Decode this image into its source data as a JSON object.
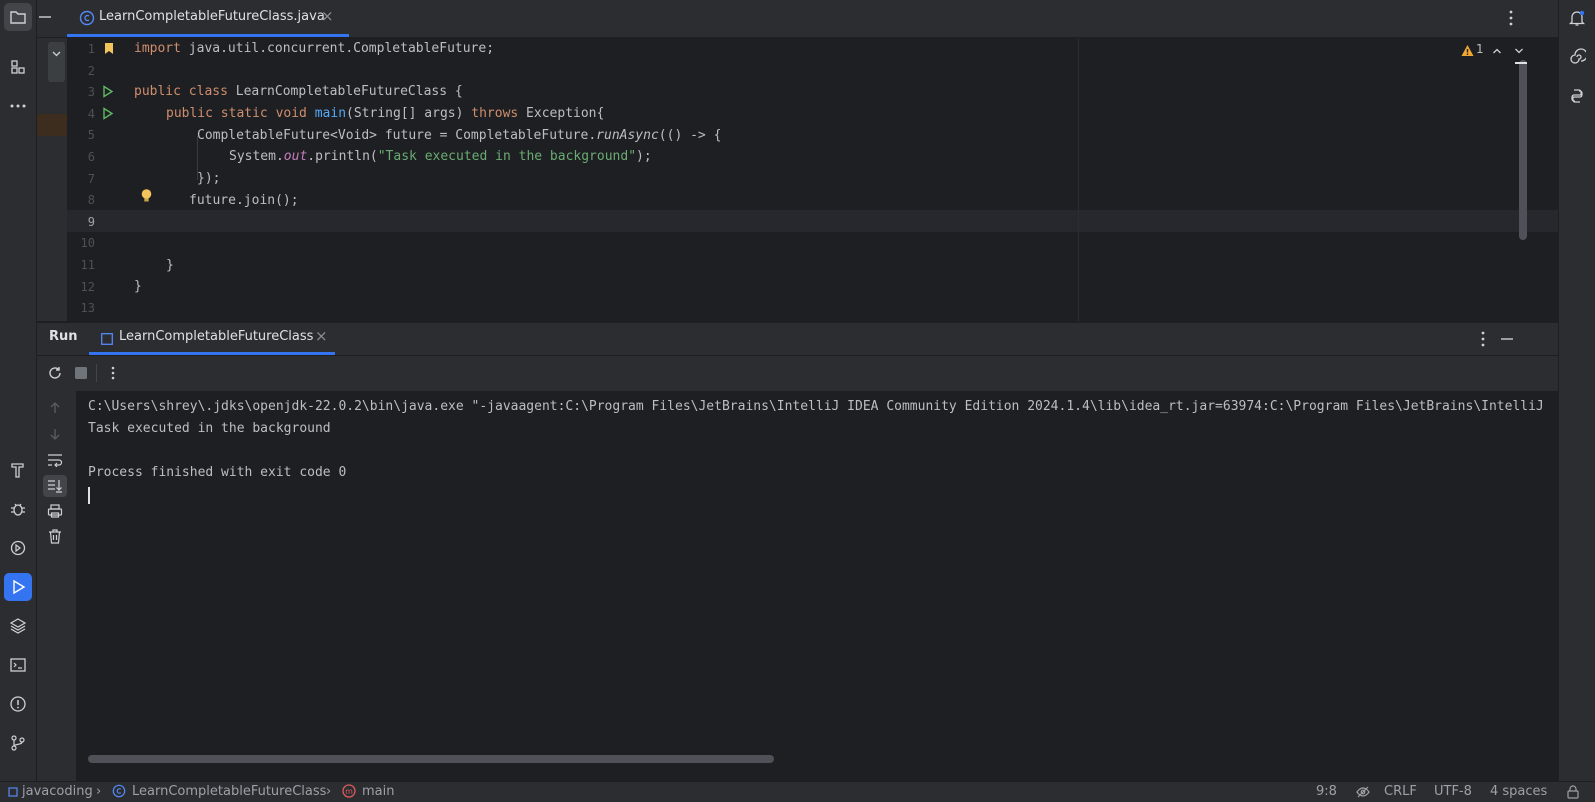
{
  "editor": {
    "tab": {
      "file_name": "LearnCompletableFutureClass.java"
    },
    "inspection": {
      "warning_count": "1"
    },
    "lines": [
      {
        "n": "1"
      },
      {
        "n": "2"
      },
      {
        "n": "3"
      },
      {
        "n": "4"
      },
      {
        "n": "5"
      },
      {
        "n": "6"
      },
      {
        "n": "7"
      },
      {
        "n": "8"
      },
      {
        "n": "9"
      },
      {
        "n": "10"
      },
      {
        "n": "11"
      },
      {
        "n": "12"
      },
      {
        "n": "13"
      }
    ],
    "code": {
      "l1_kw": "import",
      "l1_rest": " java.util.concurrent.CompletableFuture;",
      "l3_kw": "public class",
      "l3_rest": " LearnCompletableFutureClass {",
      "l4_kw1": "public static void",
      "l4_fn": "main",
      "l4_mid": "(String[] args) ",
      "l4_kw2": "throws",
      "l4_rest": " Exception{",
      "l5_a": "CompletableFuture<Void> future = CompletableFuture.",
      "l5_it": "runAsync",
      "l5_b": "(() -> {",
      "l6_a": "System.",
      "l6_it": "out",
      "l6_b": ".println(",
      "l6_str": "\"Task executed in the background\"",
      "l6_c": ");",
      "l7": "});",
      "l8": "future.join();",
      "l11": "}",
      "l12": "}"
    }
  },
  "run": {
    "title": "Run",
    "tab_label": "LearnCompletableFutureClass",
    "console_lines": [
      "C:\\Users\\shrey\\.jdks\\openjdk-22.0.2\\bin\\java.exe \"-javaagent:C:\\Program Files\\JetBrains\\IntelliJ IDEA Community Edition 2024.1.4\\lib\\idea_rt.jar=63974:C:\\Program Files\\JetBrains\\IntelliJ",
      "Task executed in the background",
      "",
      "Process finished with exit code 0"
    ]
  },
  "status": {
    "project": "javacoding",
    "class": "LearnCompletableFutureClass",
    "method": "main",
    "position": "9:8",
    "line_sep": "CRLF",
    "encoding": "UTF-8",
    "indent": "4 spaces"
  },
  "colors": {
    "accent": "#3574f0",
    "keyword": "#cf8e6d",
    "function": "#56a8f5",
    "string": "#6aab73",
    "bookmark": "#f2c55c",
    "warning": "#f0a732"
  }
}
